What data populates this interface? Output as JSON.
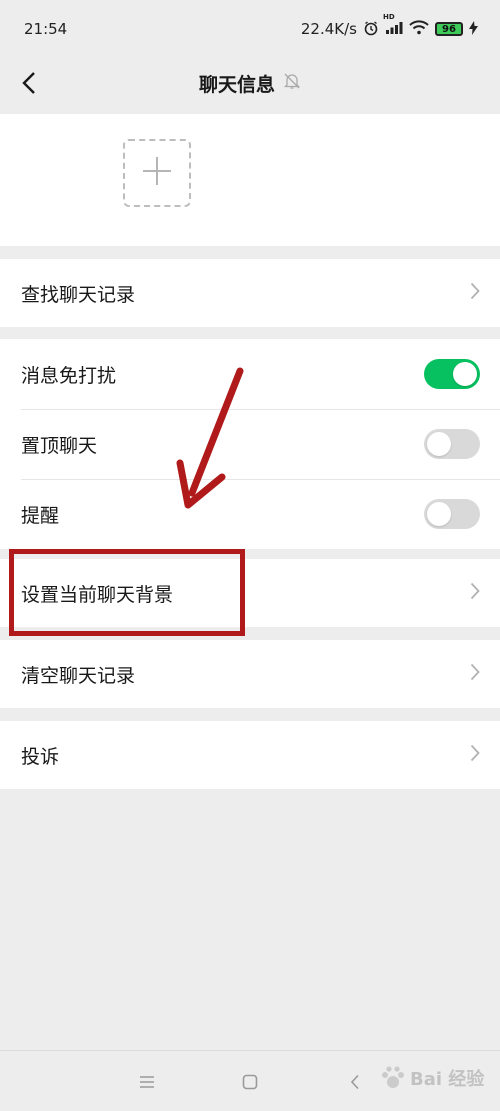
{
  "status_bar": {
    "time": "21:54",
    "network_speed": "22.4K/s",
    "hd_badge": "HD",
    "battery": "96"
  },
  "nav": {
    "title": "聊天信息",
    "icons": {
      "back": "back-chevron-icon",
      "mute": "bell-muted-icon"
    }
  },
  "members": {
    "add_icon": "plus-icon"
  },
  "rows": {
    "search_history": "查找聊天记录",
    "do_not_disturb": "消息免打扰",
    "pin_chat": "置顶聊天",
    "remind": "提醒",
    "set_background": "设置当前聊天背景",
    "clear_history": "清空聊天记录",
    "complain": "投诉"
  },
  "toggles": {
    "do_not_disturb": true,
    "pin_chat": false,
    "remind": false
  },
  "colors": {
    "toggle_on": "#07c160",
    "toggle_off": "#d9d9d9",
    "annotation": "#b01a1a"
  },
  "system_nav": {
    "icons": [
      "menu-icon",
      "home-square-icon",
      "back-icon"
    ]
  },
  "watermark": {
    "text": "Bai 经验"
  }
}
